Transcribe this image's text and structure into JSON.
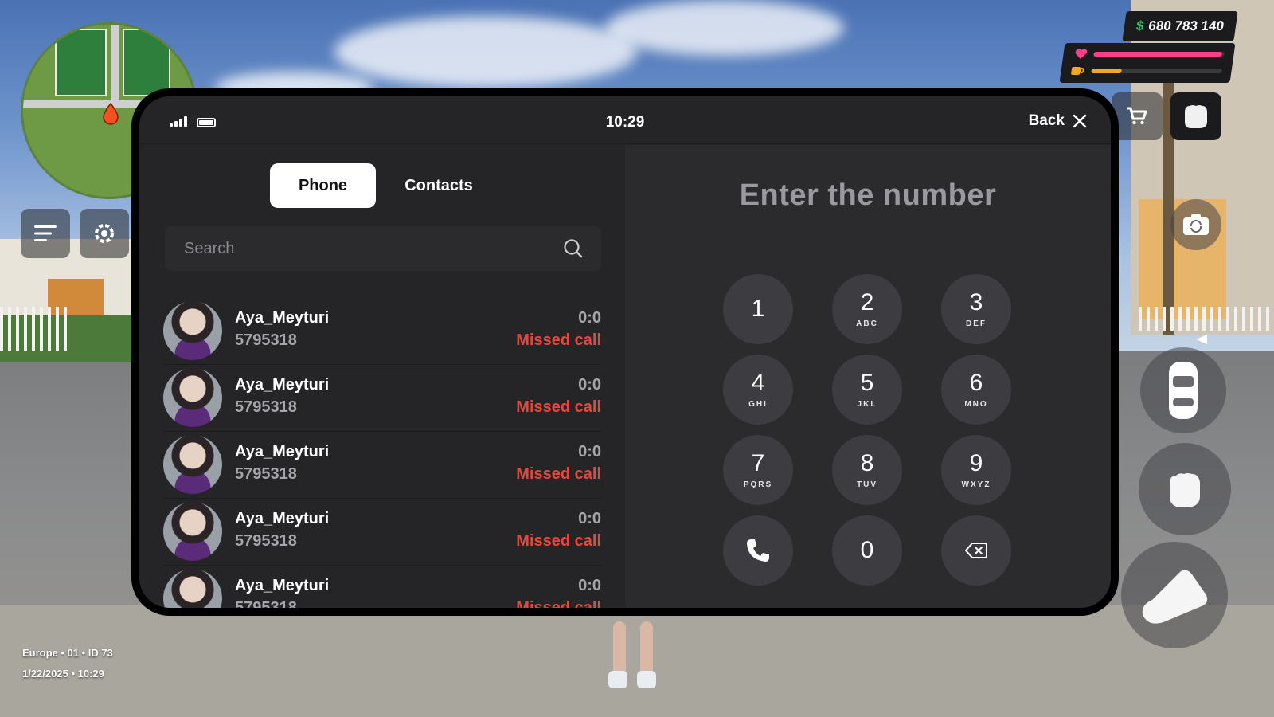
{
  "hud": {
    "money": "680 783 140",
    "money_symbol": "$",
    "health_level": 0.98,
    "hunger_level": 0.23,
    "server_line": "Europe • 01 • ID 73",
    "datetime_line": "1/22/2025 • 10:29"
  },
  "phone": {
    "time": "10:29",
    "back_label": "Back",
    "tabs": [
      {
        "label": "Phone",
        "active": true
      },
      {
        "label": "Contacts",
        "active": false
      }
    ],
    "search_placeholder": "Search",
    "calls": [
      {
        "name": "Aya_Meyturi",
        "number": "5795318",
        "duration": "0:0",
        "status": "Missed call"
      },
      {
        "name": "Aya_Meyturi",
        "number": "5795318",
        "duration": "0:0",
        "status": "Missed call"
      },
      {
        "name": "Aya_Meyturi",
        "number": "5795318",
        "duration": "0:0",
        "status": "Missed call"
      },
      {
        "name": "Aya_Meyturi",
        "number": "5795318",
        "duration": "0:0",
        "status": "Missed call"
      },
      {
        "name": "Aya_Meyturi",
        "number": "5795318",
        "duration": "0:0",
        "status": "Missed call"
      }
    ],
    "dialer": {
      "placeholder": "Enter the number",
      "keys": [
        {
          "digit": "1",
          "letters": ""
        },
        {
          "digit": "2",
          "letters": "ABC"
        },
        {
          "digit": "3",
          "letters": "DEF"
        },
        {
          "digit": "4",
          "letters": "GHI"
        },
        {
          "digit": "5",
          "letters": "JKL"
        },
        {
          "digit": "6",
          "letters": "MNO"
        },
        {
          "digit": "7",
          "letters": "PQRS"
        },
        {
          "digit": "8",
          "letters": "TUV"
        },
        {
          "digit": "9",
          "letters": "WXYZ"
        },
        {
          "digit": "0",
          "letters": ""
        }
      ]
    }
  },
  "colors": {
    "missed": "#e5473b",
    "health": "#ff3d8a",
    "hunger": "#f5a623",
    "money_symbol": "#32c46b"
  }
}
